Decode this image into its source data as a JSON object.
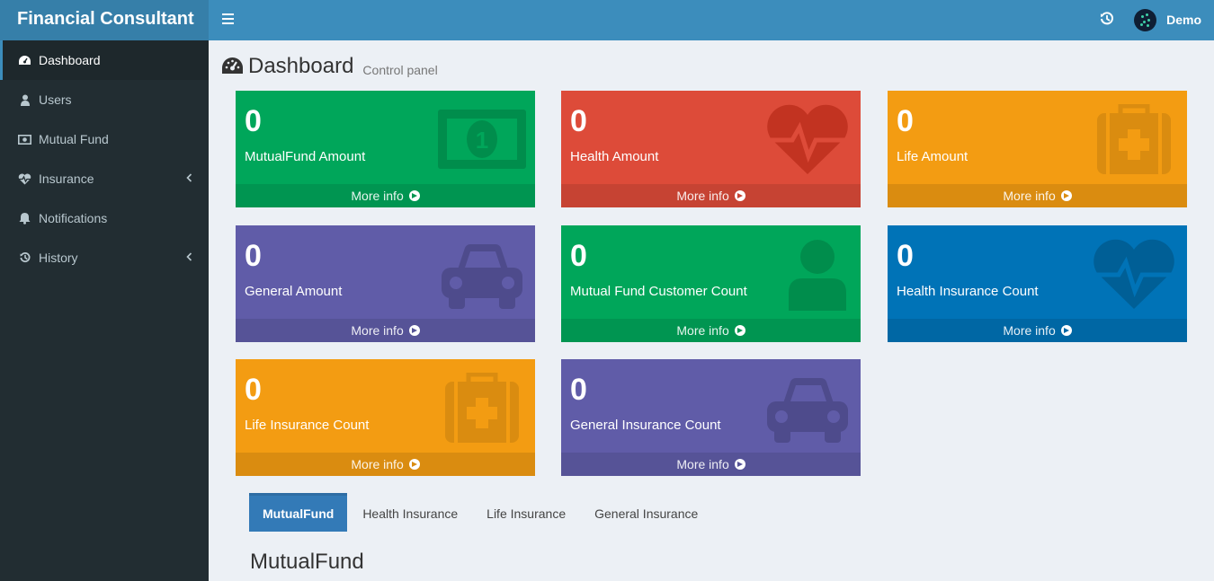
{
  "header": {
    "logo": "Financial Consultant",
    "user_name": "Demo",
    "toggle_icon": "hamburger-icon",
    "history_icon": "history-icon"
  },
  "sidebar": {
    "items": [
      {
        "label": "Dashboard",
        "icon": "dashboard-icon",
        "active": true
      },
      {
        "label": "Users",
        "icon": "user-icon"
      },
      {
        "label": "Mutual Fund",
        "icon": "money-icon"
      },
      {
        "label": "Insurance",
        "icon": "heartbeat-icon",
        "has_submenu": true
      },
      {
        "label": "Notifications",
        "icon": "bell-icon"
      },
      {
        "label": "History",
        "icon": "history-icon",
        "has_submenu": true
      }
    ]
  },
  "content": {
    "title": "Dashboard",
    "subtitle": "Control panel"
  },
  "boxes": [
    {
      "value": "0",
      "label": "MutualFund Amount",
      "more": "More info",
      "color": "#00a65a",
      "icon": "money-icon"
    },
    {
      "value": "0",
      "label": "Health Amount",
      "more": "More info",
      "color": "#dd4b39",
      "icon": "heartbeat-icon"
    },
    {
      "value": "0",
      "label": "Life Amount",
      "more": "More info",
      "color": "#f39c12",
      "icon": "medkit-icon"
    },
    {
      "value": "0",
      "label": "General Amount",
      "more": "More info",
      "color": "#605ca8",
      "icon": "car-icon"
    },
    {
      "value": "0",
      "label": "Mutual Fund Customer Count",
      "more": "More info",
      "color": "#00a65a",
      "icon": "user-icon"
    },
    {
      "value": "0",
      "label": "Health Insurance Count",
      "more": "More info",
      "color": "#0073b7",
      "icon": "heartbeat-icon"
    },
    {
      "value": "0",
      "label": "Life Insurance Count",
      "more": "More info",
      "color": "#f39c12",
      "icon": "medkit-icon"
    },
    {
      "value": "0",
      "label": "General Insurance Count",
      "more": "More info",
      "color": "#605ca8",
      "icon": "car-icon"
    }
  ],
  "tabs": [
    {
      "label": "MutualFund",
      "active": true
    },
    {
      "label": "Health Insurance"
    },
    {
      "label": "Life Insurance"
    },
    {
      "label": "General Insurance"
    }
  ],
  "section_title": "MutualFund"
}
